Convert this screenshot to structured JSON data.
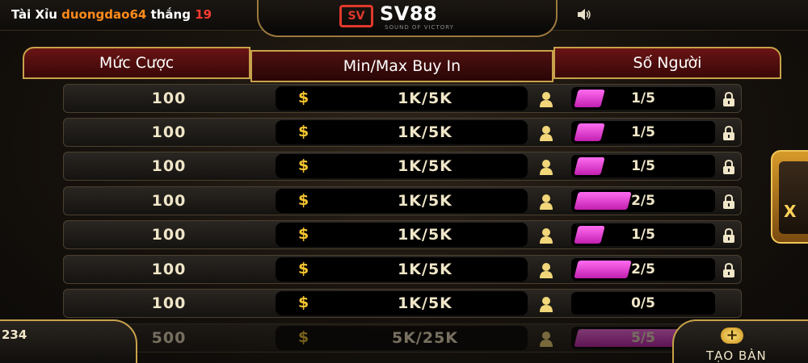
{
  "ticker": {
    "game": "Tài Xỉu",
    "user": "duongdao64",
    "action": "thắng",
    "amount": "19"
  },
  "logo": {
    "brand": "SV88",
    "tagline": "SOUND OF VICTORY",
    "badge": "SV"
  },
  "header": {
    "stake": "Mức Cược",
    "buyin": "Min/Max Buy In",
    "players": "Số Người"
  },
  "rows": [
    {
      "stake": "100",
      "currency": "$",
      "buyin": "1K/5K",
      "players": "1/5",
      "fill": 0.2,
      "locked": true
    },
    {
      "stake": "100",
      "currency": "$",
      "buyin": "1K/5K",
      "players": "1/5",
      "fill": 0.2,
      "locked": true
    },
    {
      "stake": "100",
      "currency": "$",
      "buyin": "1K/5K",
      "players": "1/5",
      "fill": 0.2,
      "locked": true
    },
    {
      "stake": "100",
      "currency": "$",
      "buyin": "1K/5K",
      "players": "2/5",
      "fill": 0.4,
      "locked": true
    },
    {
      "stake": "100",
      "currency": "$",
      "buyin": "1K/5K",
      "players": "1/5",
      "fill": 0.2,
      "locked": true
    },
    {
      "stake": "100",
      "currency": "$",
      "buyin": "1K/5K",
      "players": "2/5",
      "fill": 0.4,
      "locked": true
    },
    {
      "stake": "100",
      "currency": "$",
      "buyin": "1K/5K",
      "players": "0/5",
      "fill": 0.0,
      "locked": false
    },
    {
      "stake": "500",
      "currency": "$",
      "buyin": "5K/25K",
      "players": "5/5",
      "fill": 1.0,
      "locked": false
    }
  ],
  "balance": "234",
  "create_button": {
    "label": "TẠO BÀN",
    "icon": "plus-icon",
    "symbol": "+"
  },
  "side_card": {
    "letter": "X"
  },
  "colors": {
    "accent_gold": "#c8a24a",
    "fill_magenta": "#e83ad6",
    "username": "#ff8a1a",
    "win_amount": "#ff3b30"
  }
}
